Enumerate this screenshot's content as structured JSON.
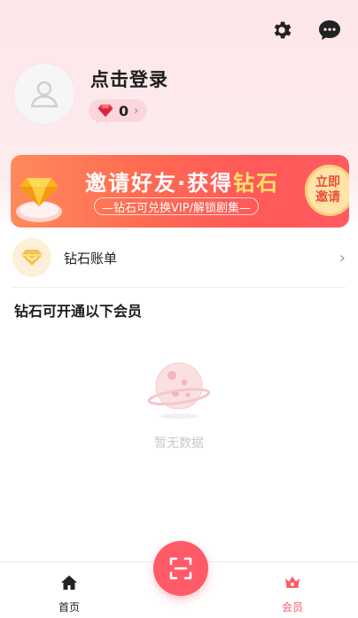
{
  "header": {
    "settings_icon": "gear-icon",
    "message_icon": "chat-bubble-icon"
  },
  "profile": {
    "login_text": "点击登录",
    "diamond_count": "0",
    "arrow": "›"
  },
  "banner": {
    "title_prefix": "邀请好友·获得",
    "title_highlight": "钻石",
    "subtitle": "—钻石可兑换VIP/解锁剧集—",
    "cta_line1": "立即",
    "cta_line2": "邀请"
  },
  "bill": {
    "label": "钻石账单",
    "arrow": "›"
  },
  "section": {
    "title": "钻石可开通以下会员"
  },
  "empty": {
    "text": "暂无数据"
  },
  "nav": {
    "home_label": "首页",
    "vip_label": "会员"
  },
  "colors": {
    "accent": "#ff5a68",
    "banner_start": "#ff8a5b",
    "banner_end": "#ff5a60",
    "highlight": "#ffe16a"
  }
}
